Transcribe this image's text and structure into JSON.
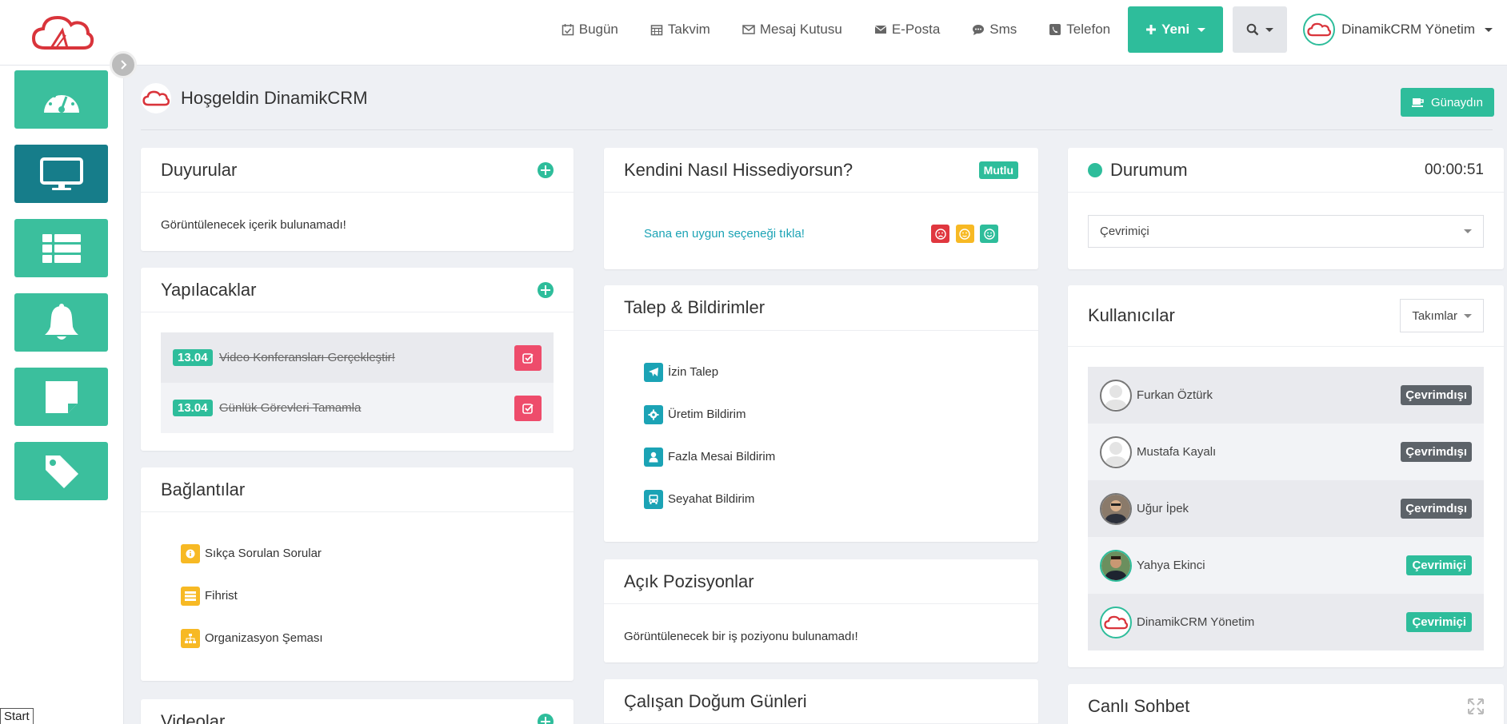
{
  "topbar": {
    "nav": [
      {
        "label": "Bugün",
        "icon": "calendar-check-icon"
      },
      {
        "label": "Takvim",
        "icon": "calendar-icon"
      },
      {
        "label": "Mesaj Kutusu",
        "icon": "envelope-outline-icon"
      },
      {
        "label": "E-Posta",
        "icon": "envelope-icon"
      },
      {
        "label": "Sms",
        "icon": "comment-icon"
      },
      {
        "label": "Telefon",
        "icon": "phone-icon"
      }
    ],
    "new_button": "Yeni",
    "user_name": "DinamikCRM Yönetim"
  },
  "header": {
    "welcome": "Hoşgeldin DinamikCRM",
    "greeting_button": "Günaydın"
  },
  "announcements": {
    "title": "Duyurular",
    "empty": "Görüntülenecek içerik bulunamadı!"
  },
  "todos": {
    "title": "Yapılacaklar",
    "items": [
      {
        "date": "13.04",
        "text": "Video Konferansları Gerçekleştir!"
      },
      {
        "date": "13.04",
        "text": "Günlük Görevleri Tamamla"
      }
    ]
  },
  "links": {
    "title": "Bağlantılar",
    "items": [
      {
        "label": "Sıkça Sorulan Sorular"
      },
      {
        "label": "Fihrist"
      },
      {
        "label": "Organizasyon Şeması"
      }
    ]
  },
  "videos": {
    "title": "Videolar"
  },
  "mood": {
    "title": "Kendini Nasıl Hissediyorsun?",
    "current": "Mutlu",
    "prompt": "Sana en uygun seçeneği tıkla!",
    "colors": {
      "sad": "#e0373f",
      "neutral": "#f7b924",
      "happy": "#2ebd9b"
    }
  },
  "requests": {
    "title": "Talep & Bildirimler",
    "items": [
      {
        "label": "İzin Talep",
        "icon": "plane-icon"
      },
      {
        "label": "Üretim Bildirim",
        "icon": "gear-icon"
      },
      {
        "label": "Fazla Mesai Bildirim",
        "icon": "user-icon"
      },
      {
        "label": "Seyahat Bildirim",
        "icon": "bus-icon"
      }
    ]
  },
  "positions": {
    "title": "Açık Pozisyonlar",
    "empty": "Görüntülenecek bir iş poziyonu bulunamadı!"
  },
  "birthdays": {
    "title": "Çalışan Doğum Günleri"
  },
  "status": {
    "title": "Durumum",
    "timer": "00:00:51",
    "selected": "Çevrimiçi"
  },
  "users": {
    "title": "Kullanıcılar",
    "filter": "Takımlar",
    "items": [
      {
        "name": "Furkan Öztürk",
        "status": "Çevrimdışı",
        "online": false
      },
      {
        "name": "Mustafa Kayalı",
        "status": "Çevrimdışı",
        "online": false
      },
      {
        "name": "Uğur İpek",
        "status": "Çevrimdışı",
        "online": false
      },
      {
        "name": "Yahya Ekinci",
        "status": "Çevrimiçi",
        "online": true
      },
      {
        "name": "DinamikCRM Yönetim",
        "status": "Çevrimiçi",
        "online": true
      }
    ]
  },
  "chat": {
    "title": "Canlı Sohbet"
  },
  "taskbar": {
    "start": "Start"
  },
  "colors": {
    "accent": "#2ebd9b",
    "sidebar_active": "#167d8a",
    "danger": "#ee4c6b",
    "warning": "#f7b924",
    "info": "#1ba3b5",
    "offline": "#5d6369"
  }
}
